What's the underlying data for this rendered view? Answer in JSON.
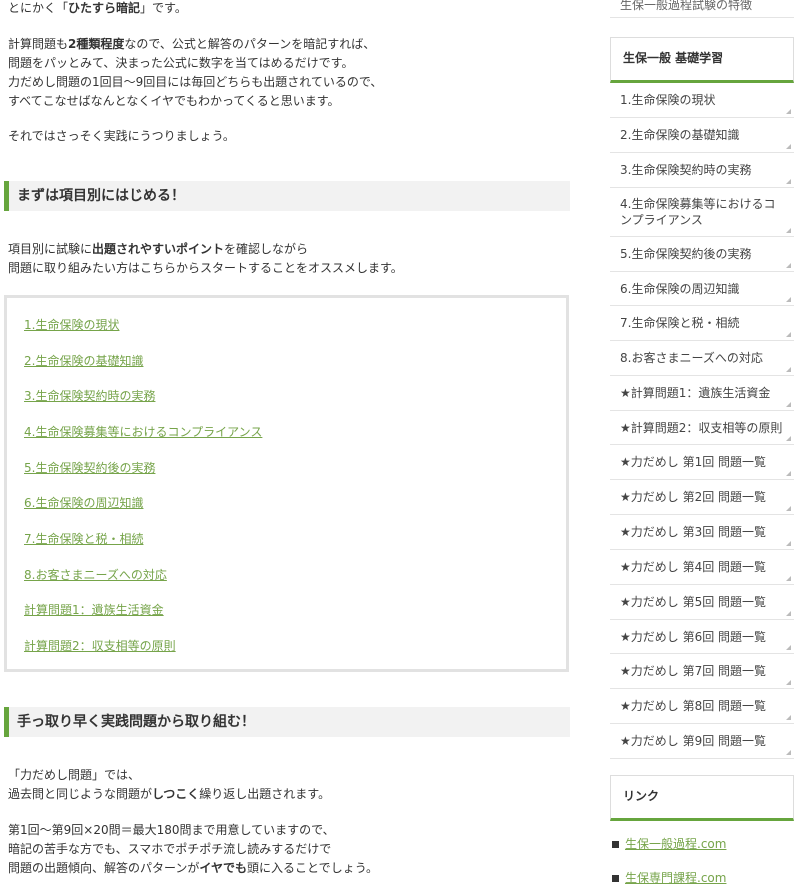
{
  "main": {
    "intro": {
      "line1_pre": "とにかく「",
      "line1_bold": "ひたすら暗記",
      "line1_post": "」です。",
      "line2_pre": "計算問題も",
      "line2_bold": "2種類程度",
      "line2_post": "なので、公式と解答のパターンを暗記すれば、",
      "line3": "問題をパッとみて、決まった公式に数字を当てはめるだけです。",
      "line4": "力だめし問題の1回目～9回目には毎回どちらも出題されているので、",
      "line5": "すべてこなせばなんとなくイヤでもわかってくると思います。",
      "line6": "それではさっそく実践にうつりましょう。"
    },
    "section1": {
      "heading": "まずは項目別にはじめる！",
      "line1_pre": "項目別に試験に",
      "line1_bold": "出題されやすいポイント",
      "line1_post": "を確認しながら",
      "line2": "問題に取り組みたい方はこちらからスタートすることをオススメします。",
      "links": [
        "1.生命保険の現状",
        "2.生命保険の基礎知識",
        "3.生命保険契約時の実務",
        "4.生命保険募集等におけるコンプライアンス",
        "5.生命保険契約後の実務",
        "6.生命保険の周辺知識",
        "7.生命保険と税・相続",
        "8.お客さまニーズへの対応",
        "計算問題1：遺族生活資金",
        "計算問題2：収支相等の原則"
      ]
    },
    "section2": {
      "heading": "手っ取り早く実践問題から取り組む！",
      "line1": "「力だめし問題」では、",
      "line2_pre": "過去問と同じような問題が",
      "line2_bold": "しつこく",
      "line2_post": "繰り返し出題されます。",
      "line3": "第1回～第9回×20問＝最大180問まで用意していますので、",
      "line4": "暗記の苦手な方でも、スマホでポチポチ流し読みするだけで",
      "line5_pre": "問題の出題傾向、解答のパターンが",
      "line5_bold": "イヤでも",
      "line5_post": "頭に入ることでしょう。"
    }
  },
  "sidebar": {
    "top_partial": "生保一般過程試験の特徴",
    "widget1_title": "生保一般 基礎学習",
    "items": [
      "1.生命保険の現状",
      "2.生命保険の基礎知識",
      "3.生命保険契約時の実務",
      "4.生命保険募集等におけるコンプライアンス",
      "5.生命保険契約後の実務",
      "6.生命保険の周辺知識",
      "7.生命保険と税・相続",
      "8.お客さまニーズへの対応",
      "★計算問題1：遺族生活資金",
      "★計算問題2：収支相等の原則",
      "★力だめし 第1回 問題一覧",
      "★力だめし 第2回 問題一覧",
      "★力だめし 第3回 問題一覧",
      "★力だめし 第4回 問題一覧",
      "★力だめし 第5回 問題一覧",
      "★力だめし 第6回 問題一覧",
      "★力だめし 第7回 問題一覧",
      "★力だめし 第8回 問題一覧",
      "★力だめし 第9回 問題一覧"
    ],
    "widget2_title": "リンク",
    "links": [
      "生保一般過程.com",
      "生保専門課程.com"
    ]
  },
  "colors": {
    "accent_green": "#66a53d",
    "link_green": "#76a44a",
    "heading_bg": "#f2f2f2"
  }
}
